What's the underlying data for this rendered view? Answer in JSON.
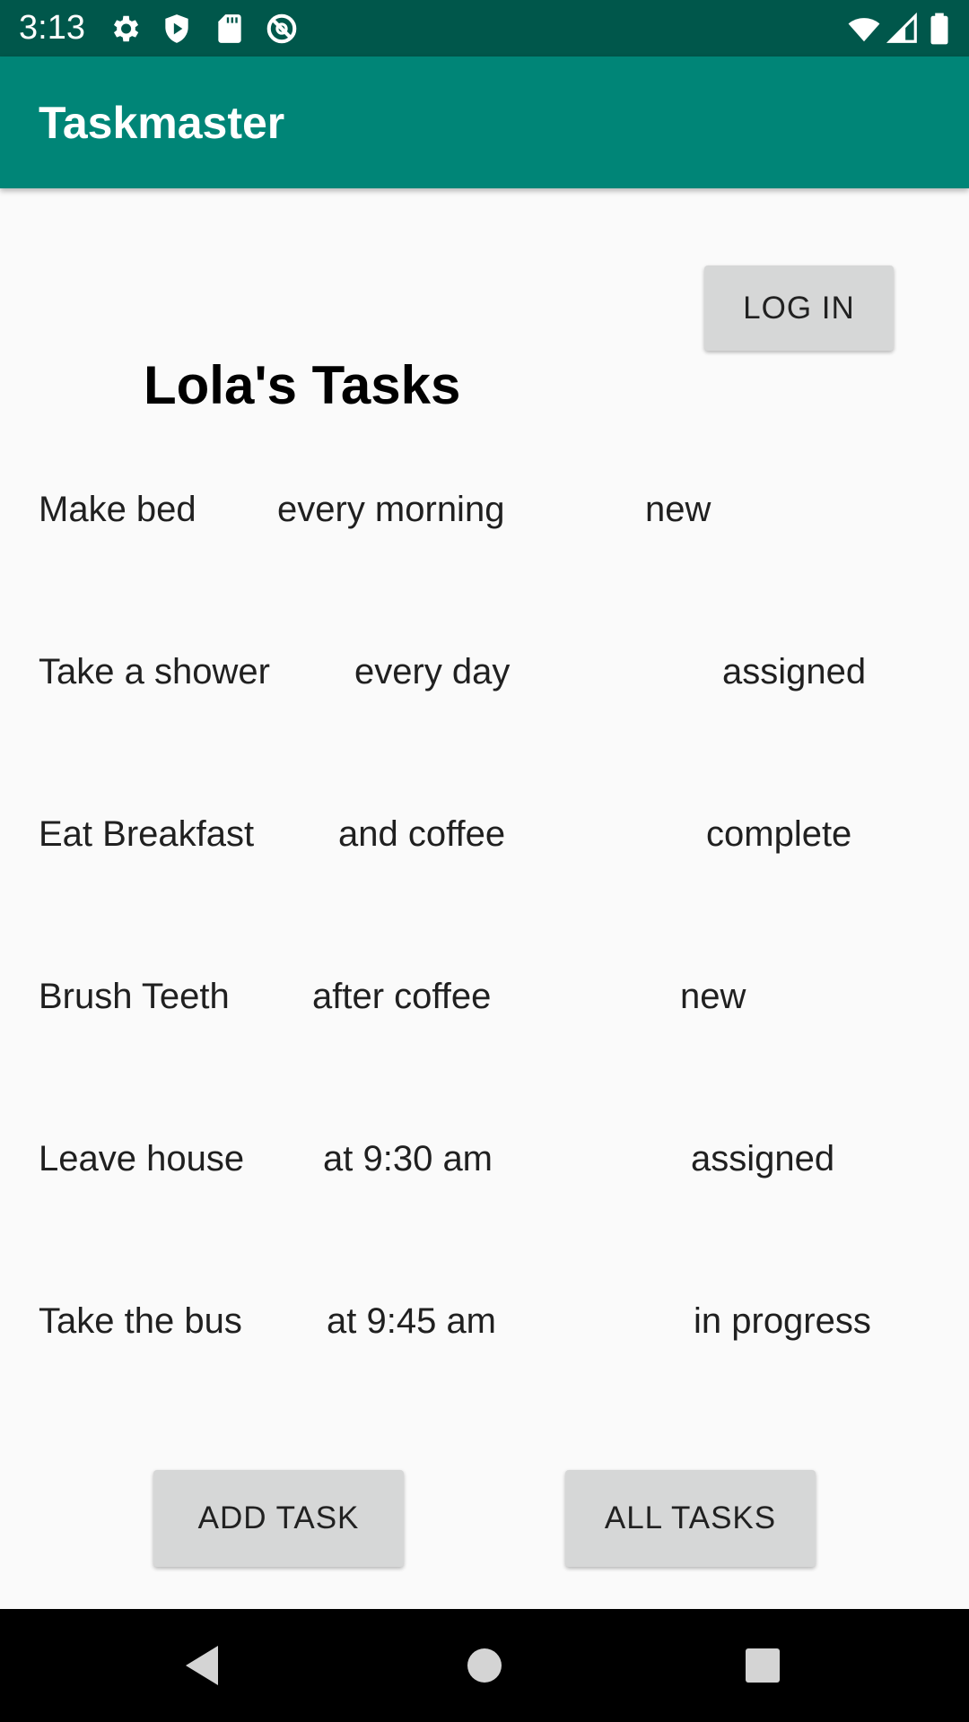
{
  "status_bar": {
    "time": "3:13",
    "left_icons": [
      "settings-gear-icon",
      "shield-play-icon",
      "sd-card-icon",
      "no-disturb-icon"
    ],
    "right_icons": [
      "wifi-icon",
      "cell-signal-icon",
      "battery-icon"
    ],
    "background": "#00574b"
  },
  "app_bar": {
    "title": "Taskmaster",
    "background": "#008577"
  },
  "login_button": {
    "label": "LOG IN"
  },
  "heading": "Lola's Tasks",
  "tasks": [
    {
      "title": "Make bed",
      "body": "every morning",
      "state": "new"
    },
    {
      "title": "Take a shower",
      "body": "every day",
      "state": "assigned"
    },
    {
      "title": "Eat Breakfast",
      "body": "and coffee",
      "state": "complete"
    },
    {
      "title": "Brush Teeth",
      "body": "after coffee",
      "state": "new"
    },
    {
      "title": "Leave house",
      "body": "at 9:30 am",
      "state": "assigned"
    },
    {
      "title": "Take the bus",
      "body": "at 9:45 am",
      "state": "in progress"
    }
  ],
  "buttons": {
    "add_task": "ADD TASK",
    "all_tasks": "ALL TASKS"
  },
  "nav_bar": {
    "icons": [
      "back-triangle-icon",
      "home-circle-icon",
      "recents-square-icon"
    ]
  }
}
